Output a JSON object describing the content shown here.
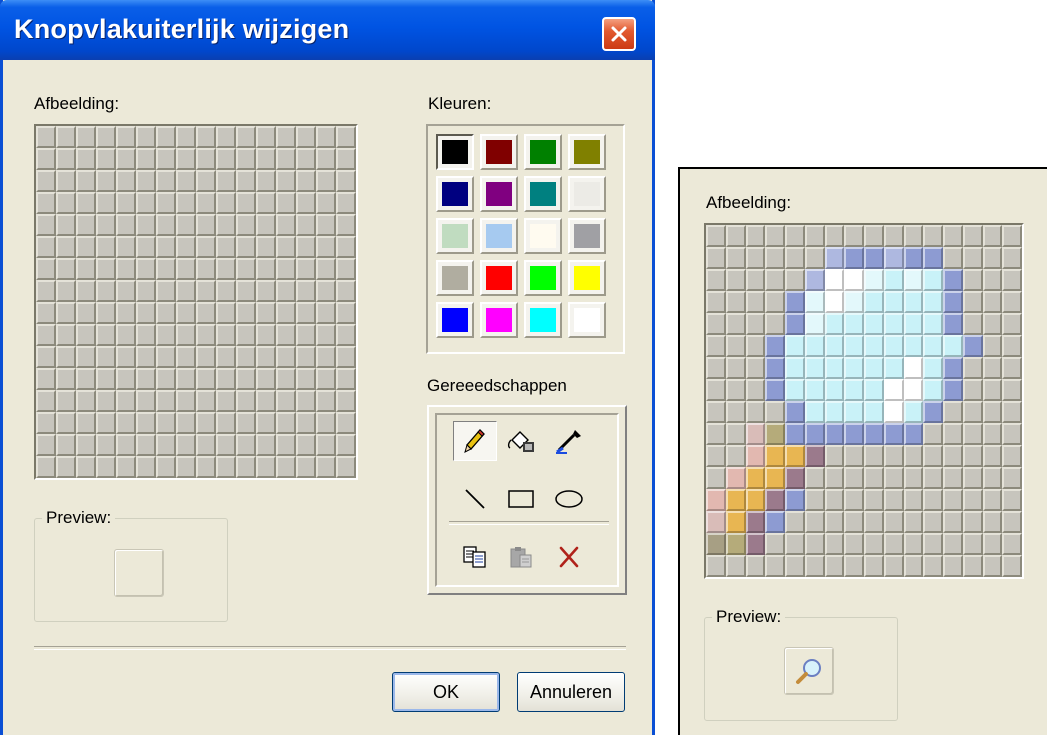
{
  "dialog": {
    "title": "Knopvlakuiterlijk wijzigen",
    "picture_label": "Afbeelding:",
    "colors_label": "Kleuren:",
    "tools_label": "Gereeedschappen",
    "preview_label": "Preview:",
    "ok_label": "OK",
    "cancel_label": "Annuleren"
  },
  "palette": [
    "#000000",
    "#800000",
    "#008000",
    "#808000",
    "#000080",
    "#800080",
    "#008080",
    "#ecebe6",
    "#c0dcc0",
    "#a6caf0",
    "#fffbf0",
    "#a0a0a4",
    "#b0ada0",
    "#ff0000",
    "#00ff00",
    "#ffff00",
    "#0000ff",
    "#ff00ff",
    "#00ffff",
    "#ffffff"
  ],
  "tools": [
    {
      "name": "pencil-icon",
      "label": "pencil"
    },
    {
      "name": "fill-icon",
      "label": "fill"
    },
    {
      "name": "color-picker-icon",
      "label": "pick color"
    },
    {
      "name": "line-icon",
      "label": "line"
    },
    {
      "name": "rectangle-icon",
      "label": "rectangle"
    },
    {
      "name": "ellipse-icon",
      "label": "ellipse"
    },
    {
      "name": "copy-icon",
      "label": "copy"
    },
    {
      "name": "paste-icon",
      "label": "paste"
    },
    {
      "name": "delete-icon",
      "label": "delete"
    }
  ],
  "zoom": {
    "picture_label": "Afbeelding:",
    "preview_label": "Preview:"
  }
}
